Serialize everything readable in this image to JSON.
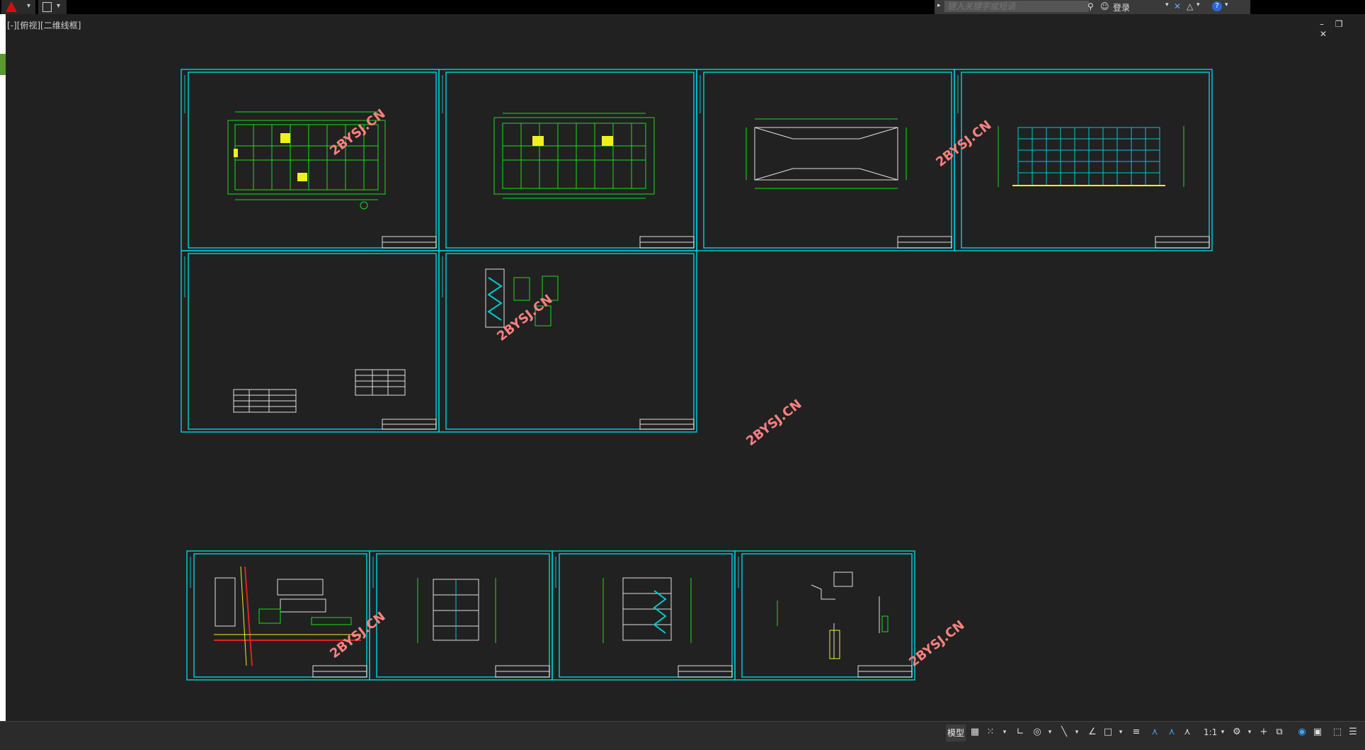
{
  "toolbar": {
    "app_menu_icon": "autocad-a-logo",
    "quick_access_icon": "save-icon",
    "search_placeholder": "键入关键字或短语",
    "binoculars_icon": "binoculars-icon",
    "user_icon": "user-icon",
    "login_label": "登录",
    "exchange_icon": "x-exchange-icon",
    "community_icon": "a360-icon",
    "help_icon": "help-icon"
  },
  "viewport": {
    "label": "[-][俯视][二维线框]",
    "window_controls": [
      "–",
      "❐",
      "✕"
    ]
  },
  "watermark": "2BYSJ.CN",
  "statusbar": {
    "model_label": "模型",
    "scale_label": "1:1",
    "icons": [
      "grid-icon",
      "snap-icon",
      "ortho-icon",
      "polar-icon",
      "osnap-icon",
      "otrack-icon",
      "lineweight-icon",
      "transparency-icon",
      "selection-cycling-icon",
      "annotation-visibility-icon",
      "auto-scale-icon",
      "annotation-scale-icon",
      "workspace-gear-icon",
      "plus-icon",
      "isolate-icon",
      "hardware-accel-icon",
      "clean-screen-icon",
      "customize-icon"
    ]
  },
  "colors": {
    "background": "#212121",
    "frame": "#00c8d2",
    "linework": "#18e018",
    "highlight": "#f0f020",
    "watermark": "#ff8080",
    "statusbar": "#2b2b2b"
  }
}
